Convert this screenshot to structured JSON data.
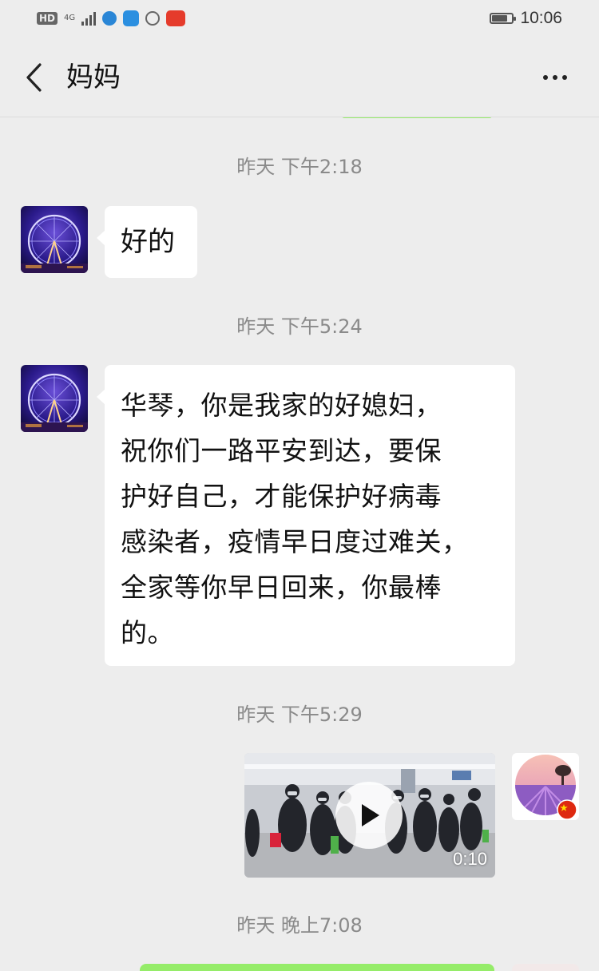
{
  "status_bar": {
    "hd": "HD",
    "network": "4G",
    "time": "10:06",
    "battery_level": 0.8
  },
  "header": {
    "title": "妈妈",
    "back_icon": "chevron-left-icon",
    "more_icon": "more-dots-icon"
  },
  "messages": [
    {
      "type": "timestamp",
      "text": "昨天 下午2:18"
    },
    {
      "type": "text",
      "sender": "contact",
      "text": "好的"
    },
    {
      "type": "timestamp",
      "text": "昨天 下午5:24"
    },
    {
      "type": "text",
      "sender": "contact",
      "text": "华琴，你是我家的好媳妇，\n祝你们一路平安到达，要保\n护好自己，才能保护好病毒\n感染者，疫情早日度过难关，\n全家等你早日回来，你最棒\n的。"
    },
    {
      "type": "timestamp",
      "text": "昨天 下午5:29"
    },
    {
      "type": "video",
      "sender": "self",
      "duration": "0:10"
    },
    {
      "type": "timestamp",
      "text": "昨天 晚上7:08"
    }
  ],
  "colors": {
    "background": "#ededed",
    "self_bubble": "#95ec69",
    "contact_bubble": "#ffffff",
    "timestamp": "#8a8a8a"
  }
}
